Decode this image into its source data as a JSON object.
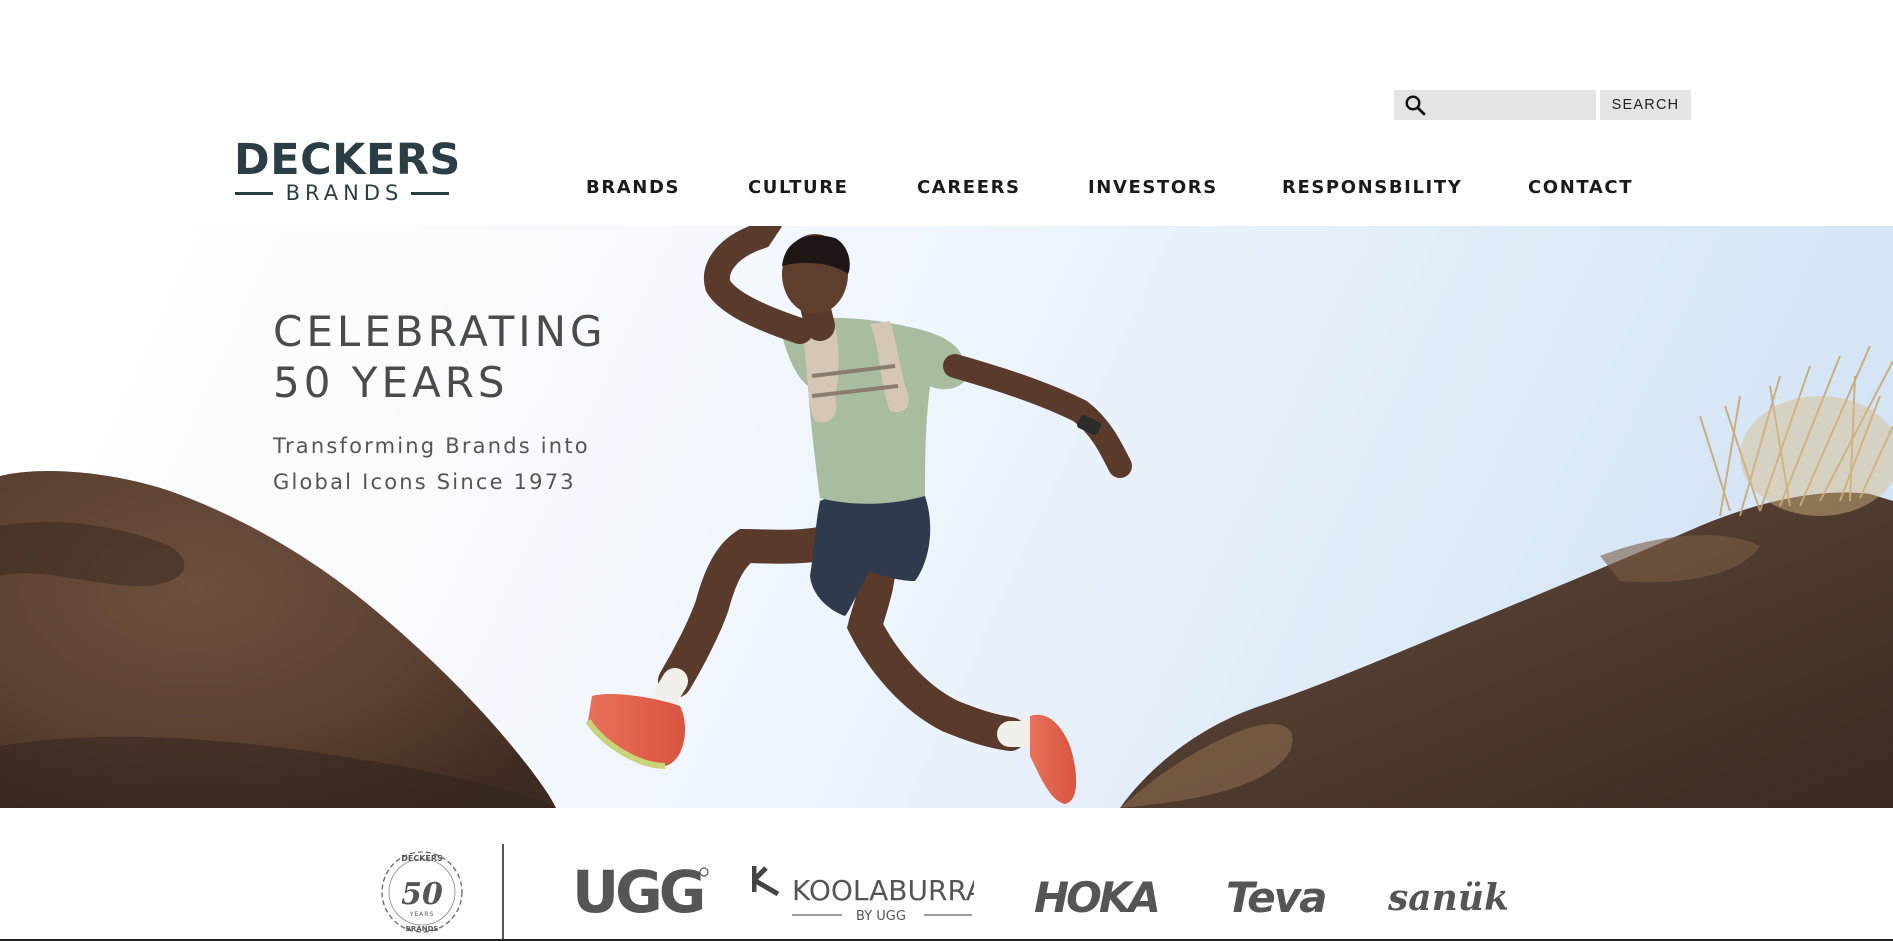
{
  "header": {
    "logo": {
      "name": "DECKERS",
      "sub": "BRANDS"
    },
    "search": {
      "placeholder": "",
      "value": "",
      "button_label": "SEARCH"
    },
    "nav": [
      {
        "label": "BRANDS"
      },
      {
        "label": "CULTURE"
      },
      {
        "label": "CAREERS"
      },
      {
        "label": "INVESTORS"
      },
      {
        "label": "RESPONSBILITY"
      },
      {
        "label": "CONTACT"
      }
    ]
  },
  "hero": {
    "title_line1": "CELEBRATING",
    "title_line2": "50 YEARS",
    "subtitle_line1": "Transforming Brands into",
    "subtitle_line2": "Global Icons Since 1973"
  },
  "brand_strip": {
    "anniversary_badge": {
      "top": "DECKERS",
      "number": "50",
      "middle": "YEARS",
      "bottom": "BRANDS"
    },
    "brands": [
      {
        "name": "UGG",
        "icon": "ugg-logo"
      },
      {
        "name": "KOOLABURRA",
        "sub": "BY UGG",
        "icon": "koolaburra-logo"
      },
      {
        "name": "HOKA",
        "icon": "hoka-logo"
      },
      {
        "name": "Teva",
        "icon": "teva-logo"
      },
      {
        "name": "sanük",
        "icon": "sanuk-logo"
      }
    ]
  },
  "colors": {
    "logo": "#2c3e45",
    "nav_text": "#1a1a1a",
    "hero_text": "#4b4b4b",
    "search_bg": "#e4e4e4",
    "brand_logo_gray": "#555555"
  }
}
